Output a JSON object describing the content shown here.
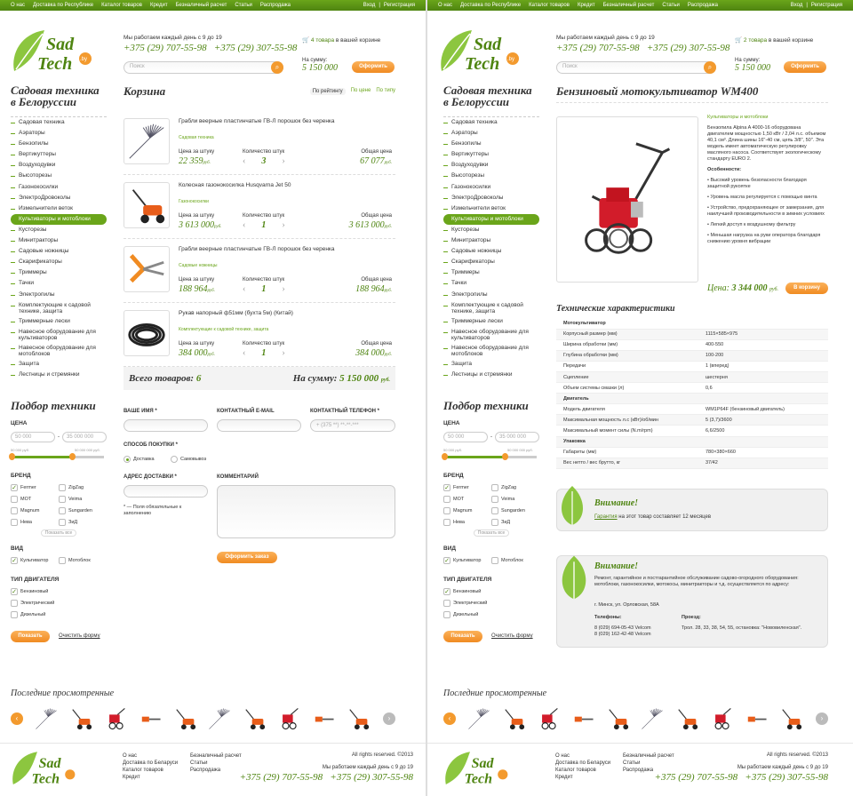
{
  "top_nav": [
    "О нас",
    "Доставка по Республике",
    "Каталог товаров",
    "Кредит",
    "Безналичный расчет",
    "Статьи",
    "Распродажа"
  ],
  "auth": {
    "login": "Вход",
    "sep": "|",
    "register": "Регистрация"
  },
  "logo": {
    "line1": "Sad",
    "line2": "Tech",
    "tld": ".by"
  },
  "header": {
    "hours": "Мы работаем каждый день с 9 до 19",
    "phone1": "+375 (29) 707-55-98",
    "phone2": "+375 (29) 307-55-98",
    "search_placeholder": "Поиск",
    "sum_label": "На сумму:",
    "sum_value": "5 150 000",
    "order_button": "Оформить",
    "cart_left_count": "4 товара",
    "cart_right_count": "2 товара",
    "cart_suffix": "в вашей корзине"
  },
  "sidebar": {
    "title": "Садовая техника в Белоруссии",
    "categories": [
      "Садовая техника",
      "Аэраторы",
      "Бензопилы",
      "Вертикуттеры",
      "Воздуходувки",
      "Высоторезы",
      "Газонокосилки",
      "ЭлектроДровоколы",
      "Измельчители веток",
      "Культиваторы и мотоблоки",
      "Кусторезы",
      "Минитракторы",
      "Садовые ножницы",
      "Скарификаторы",
      "Триммеры",
      "Тачки",
      "Электропилы",
      "Комплектующие к садовой технике, защита",
      "Триммерные лески",
      "Навесное оборудование для культиваторов",
      "Навесное оборудование для мотоблоков",
      "Защита",
      "Лестницы и стремянки"
    ],
    "active": "Культиваторы и мотоблоки"
  },
  "filter": {
    "title": "Подбор техники",
    "price_label": "ЦЕНА",
    "price_min": "50 000",
    "price_max": "35 000 000",
    "price_min_small": "50 000 руб.",
    "price_max_small": "50 000 000 руб.",
    "brand_label": "БРЕНД",
    "brands": [
      "Fermer",
      "ZigZag",
      "MOT",
      "Veima",
      "Magnum",
      "Sungarden",
      "Нева",
      "ЗиД"
    ],
    "show_all": "Показать все",
    "kind_label": "ВИД",
    "kinds": [
      "Культиватор",
      "Мотоблок"
    ],
    "engine_label": "ТИП ДВИГАТЕЛЯ",
    "engines": [
      "Бензиновый",
      "Электрический",
      "Дизельный"
    ],
    "show_button": "Показать",
    "clear_link": "Очистить форму"
  },
  "cart": {
    "title": "Корзина",
    "sort": [
      "По рейтингу",
      "По цене",
      "По типу"
    ],
    "unit_price_label": "Цена за штуку",
    "qty_label": "Количество штук",
    "total_label": "Общая цена",
    "items": [
      {
        "name": "Грабли веерные пластинчатые ГВ-Л порошок без черенка",
        "category": "Садовая техника",
        "price": "22 359",
        "qty": "3",
        "total": "67 077"
      },
      {
        "name": "Колесная газонокосилка Husqvarna Jet 50",
        "category": "Газонокосилки",
        "price": "3 613 000",
        "qty": "1",
        "total": "3 613 000"
      },
      {
        "name": "Грабли веерные пластинчатые ГВ-Л порошок без черенка",
        "category": "Садовые ножницы",
        "price": "188 964",
        "qty": "1",
        "total": "188 964"
      },
      {
        "name": "Рукав напорный ф51мм (бухта 5м) (Китай)",
        "category": "Комплектующие к садовой технике, защита",
        "price": "384 000",
        "qty": "1",
        "total": "384 000"
      }
    ],
    "currency": "руб.",
    "total_goods": "Всего товаров:",
    "total_goods_value": "6",
    "total_sum": "На сумму:",
    "total_sum_value": "5 150 000"
  },
  "form": {
    "name_label": "ВАШЕ ИМЯ *",
    "email_label": "КОНТАКТНЫЙ E-MAIL",
    "phone_label": "КОНТАКТНЫЙ ТЕЛЕФОН *",
    "phone_placeholder": "+ (375 **) **-**-***",
    "purchase_label": "СПОСОБ ПОКУПКИ *",
    "delivery": "Доставка",
    "pickup": "Самовывоз",
    "address_label": "АДРЕС ДОСТАВКИ *",
    "comment_label": "КОММЕНТАРИЙ",
    "required_note": "* — Поля обязательные к заполнению",
    "submit": "Оформить заказ"
  },
  "recent": {
    "title": "Последние просмотренные"
  },
  "footer": {
    "col1": [
      "О нас",
      "Доставка по Беларуси",
      "Каталог товаров",
      "Кредит"
    ],
    "col2": [
      "Безналичный расчет",
      "Статьи",
      "Распродажа"
    ],
    "rights": "All rights reserved. ©2013"
  },
  "product": {
    "title": "Бензиновый мотокультиватор WM400",
    "category": "Культиваторы и мотоблоки",
    "desc": "Бензопила Alpina A 4000-16 оборудована двигателем мощностью 1,50 кВт / 2,04 л.с. объемом 40,1 см³. Длина шины 16\"-40 см, цепь 3/8\", 50\". Эта модель имеет автоматическую регулировку масляного насоса. Соответствует экологическому стандарту EURO 2.",
    "features_title": "Особенности:",
    "features": [
      "• Высокий уровень безопасности благодаря защитной рукоятке",
      "• Уровень масла регулируется с помощью винта",
      "• Устройство, предохраняющее от замерзания, для наилучшей производительности в зимних условиях",
      "• Легкий доступ к воздушному фильтру",
      "• Меньшая нагрузка на руки оператора благодаря снижению уровня вибрации"
    ],
    "price_label": "Цена:",
    "price": "3 344 000",
    "cart_button": "В корзину",
    "specs_title": "Технические характеристики",
    "specs": [
      [
        "Мотокультиватор",
        ""
      ],
      [
        "Корпусный размер (мм)",
        "1115×585×975"
      ],
      [
        "Ширина обработки (мм)",
        "400-550"
      ],
      [
        "Глубина обработки (мм)",
        "100-200"
      ],
      [
        "Передачи",
        "1 (вперед)"
      ],
      [
        "Сцепление",
        "шестерня"
      ],
      [
        "Объем системы смазки (л)",
        "0,6"
      ],
      [
        "Двигатель",
        ""
      ],
      [
        "Модель двигателя",
        "WM1P64F (бензиновый двигатель)"
      ],
      [
        "Максимальная мощность л.с (кВт)/об/мин",
        "5 (3,7)/3600"
      ],
      [
        "Максимальный момент силы (N.m/rpm)",
        "6,6/2500"
      ],
      [
        "Упаковка",
        ""
      ],
      [
        "Габариты (мм)",
        "780×380×660"
      ],
      [
        "Вес нетто / вес брутто, кг",
        "37/42"
      ]
    ],
    "attention1_title": "Внимание!",
    "attention1_link": "Гарантия",
    "attention1_text": "на этот товар составляет 12 месяцев",
    "attention2_title": "Внимание!",
    "attention2_text": "Ремонт, гарантийное и постгарантийное обслуживание садово-огородного оборудования: мотоблоки, газонокосилки, мотокосы, минитракторы и т.д. осуществляется по адресу:",
    "attention2_address": "г. Минск, ул. Орловская, 58А",
    "phones_label": "Телефоны:",
    "phones": [
      "8 (029) 694-05-43 Velcom",
      "8 (029) 162-42-48 Velcom"
    ],
    "route_label": "Проезд:",
    "route": "Трол. 28, 33, 38, 54, 55, остановка: \"Нововиленская\"."
  },
  "colors": {
    "green": "#6aa51a",
    "dark_green": "#4e8410",
    "orange": "#f39a2e"
  }
}
